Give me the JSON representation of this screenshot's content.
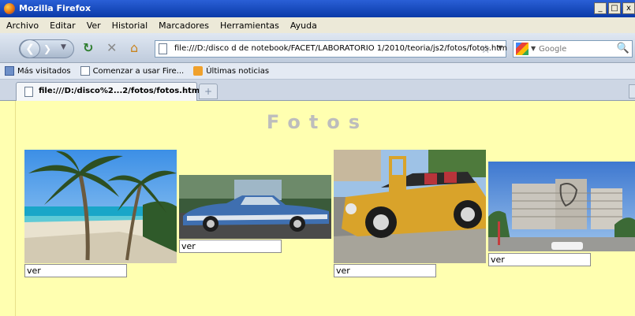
{
  "window": {
    "title": "Mozilla Firefox",
    "controls": [
      "_",
      "□",
      "x"
    ]
  },
  "menu": [
    "Archivo",
    "Editar",
    "Ver",
    "Historial",
    "Marcadores",
    "Herramientas",
    "Ayuda"
  ],
  "toolbar": {
    "url": "file:///D:/disco d de notebook/FACET/LABORATORIO 1/2010/teoria/js2/fotos/fotos.htm",
    "search_placeholder": "Google"
  },
  "bookmarks": [
    "Más visitados",
    "Comenzar a usar Fire...",
    "Últimas noticias"
  ],
  "tabs": [
    {
      "label": "file:///D:/disco%2...2/fotos/fotos.htm"
    }
  ],
  "page": {
    "heading": "Fotos",
    "photos": [
      {
        "subject": "beach with palm trees",
        "input_value": "ver"
      },
      {
        "subject": "blue classic car",
        "input_value": "ver"
      },
      {
        "subject": "yellow vintage car",
        "input_value": "ver"
      },
      {
        "subject": "plaza with buildings",
        "input_value": "ver"
      }
    ]
  },
  "colors": {
    "page_background": "#ffffb0",
    "heading": "#bdbdbd",
    "titlebar": "#0a3aa8"
  }
}
